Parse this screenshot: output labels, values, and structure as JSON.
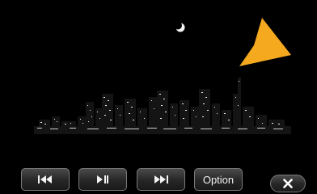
{
  "player": {
    "controls": {
      "prev_icon": "skip-previous-icon",
      "play_pause_icon": "play-pause-icon",
      "next_icon": "skip-next-icon",
      "option_label": "Option",
      "close_icon": "close-icon"
    },
    "navigation_pointer": {
      "icon": "navigation-arrow-icon",
      "color": "#f5a91f"
    },
    "video_scene": "night-city-skyline"
  },
  "colors": {
    "background": "#000000",
    "button_border": "#7a7a7a",
    "accent": "#f5a91f"
  }
}
